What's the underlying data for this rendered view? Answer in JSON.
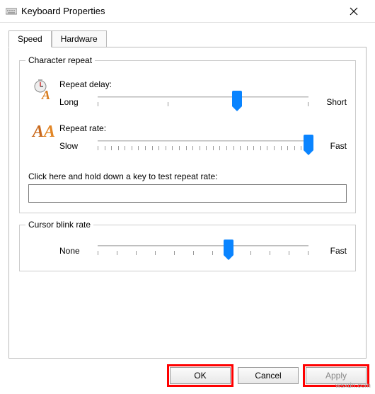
{
  "window": {
    "title": "Keyboard Properties"
  },
  "tabs": {
    "speed": "Speed",
    "hardware": "Hardware"
  },
  "charRepeat": {
    "legend": "Character repeat",
    "delay": {
      "label": "Repeat delay:",
      "leftEnd": "Long",
      "rightEnd": "Short",
      "position_percent": 66
    },
    "rate": {
      "label": "Repeat rate:",
      "leftEnd": "Slow",
      "rightEnd": "Fast",
      "position_percent": 100
    },
    "testLabel": "Click here and hold down a key to test repeat rate:",
    "testValue": ""
  },
  "cursorBlink": {
    "legend": "Cursor blink rate",
    "slider": {
      "leftEnd": "None",
      "rightEnd": "Fast",
      "position_percent": 62
    }
  },
  "buttons": {
    "ok": "OK",
    "cancel": "Cancel",
    "apply": "Apply"
  },
  "watermark": "wsxdn.com",
  "colors": {
    "accent": "#0a84ff",
    "highlight": "#ff0000"
  }
}
